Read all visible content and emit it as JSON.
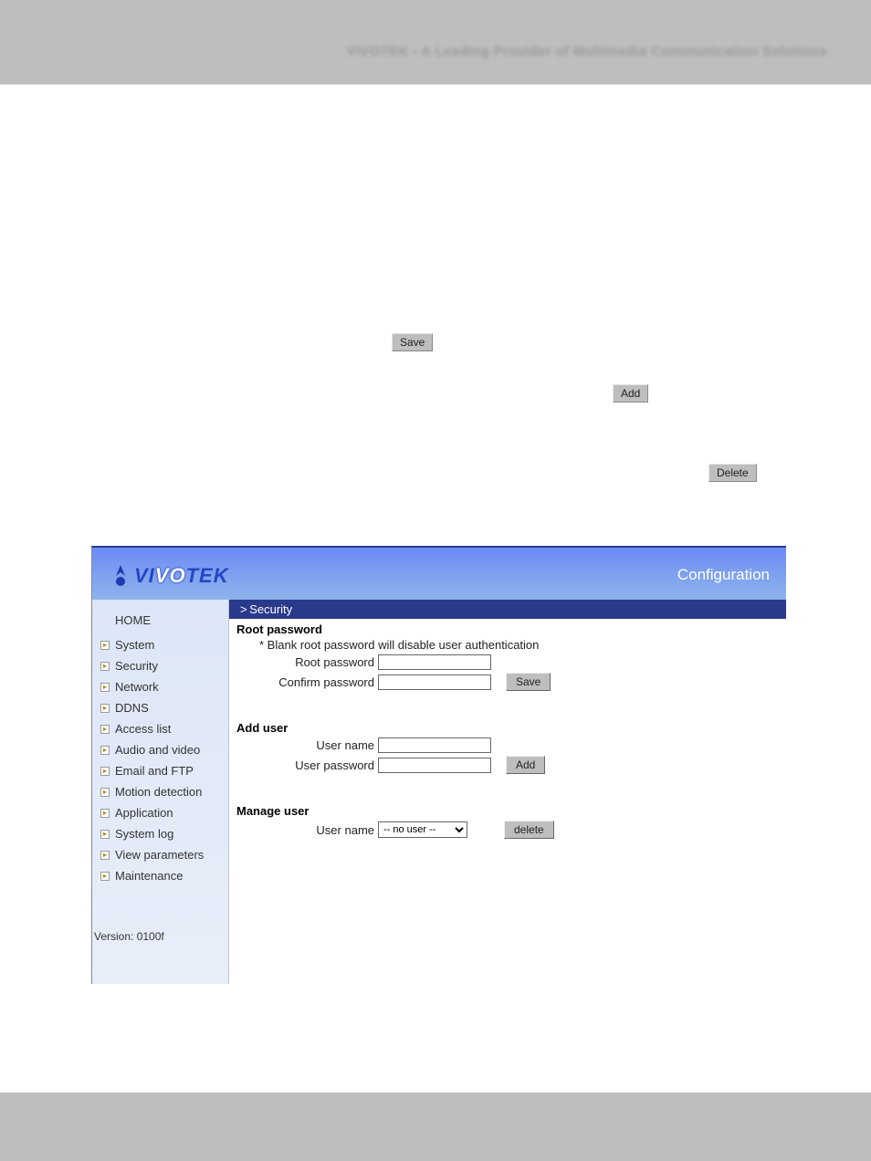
{
  "top": {
    "blurred": "VIVOTEK - A Leading Provider of Multimedia Communication Solutions"
  },
  "floating": {
    "save": "Save",
    "add": "Add",
    "delete": "Delete"
  },
  "header": {
    "brand_full": "VIVOTEK",
    "config": "Configuration"
  },
  "crumb": "> Security",
  "nav": {
    "home": "HOME",
    "items": [
      "System",
      "Security",
      "Network",
      "DDNS",
      "Access list",
      "Audio and video",
      "Email and FTP",
      "Motion detection",
      "Application",
      "System log",
      "View parameters",
      "Maintenance"
    ],
    "version": "Version: 0100f"
  },
  "root_pw": {
    "title": "Root password",
    "note": "* Blank root password will disable user authentication",
    "label_pw": "Root password",
    "label_confirm": "Confirm password",
    "btn": "Save"
  },
  "add_user": {
    "title": "Add user",
    "label_name": "User name",
    "label_pw": "User password",
    "btn": "Add"
  },
  "manage_user": {
    "title": "Manage user",
    "label_name": "User name",
    "selected": "-- no user --",
    "btn": "delete"
  }
}
